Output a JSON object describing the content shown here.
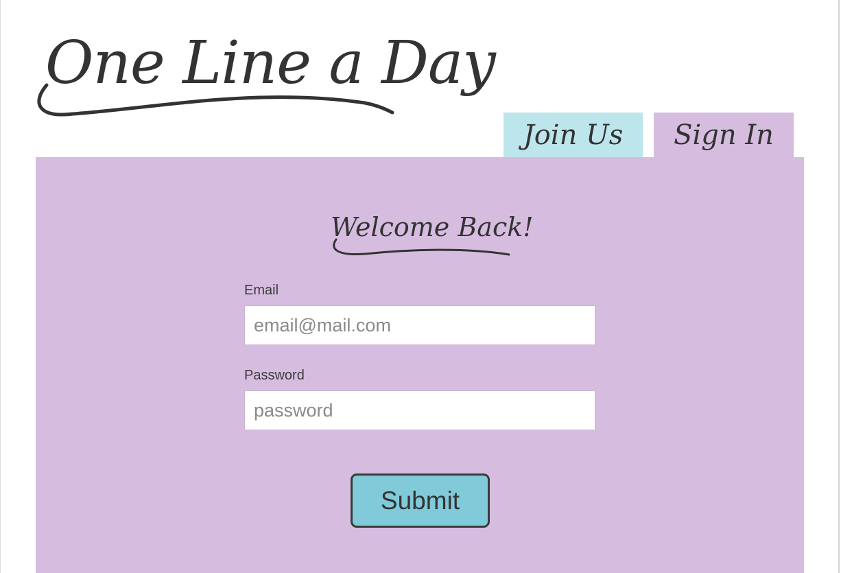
{
  "brand": {
    "logo_text": "One Line a Day"
  },
  "tabs": [
    {
      "label": "Join Us",
      "active": false
    },
    {
      "label": "Sign In",
      "active": true
    }
  ],
  "form": {
    "heading": "Welcome Back!",
    "email": {
      "label": "Email",
      "placeholder": "email@mail.com",
      "value": ""
    },
    "password": {
      "label": "Password",
      "placeholder": "password",
      "value": ""
    },
    "submit_label": "Submit"
  },
  "colors": {
    "panel": "#d6bde0",
    "join_tab": "#bde5ec",
    "button": "#80cad9",
    "text": "#333333"
  }
}
